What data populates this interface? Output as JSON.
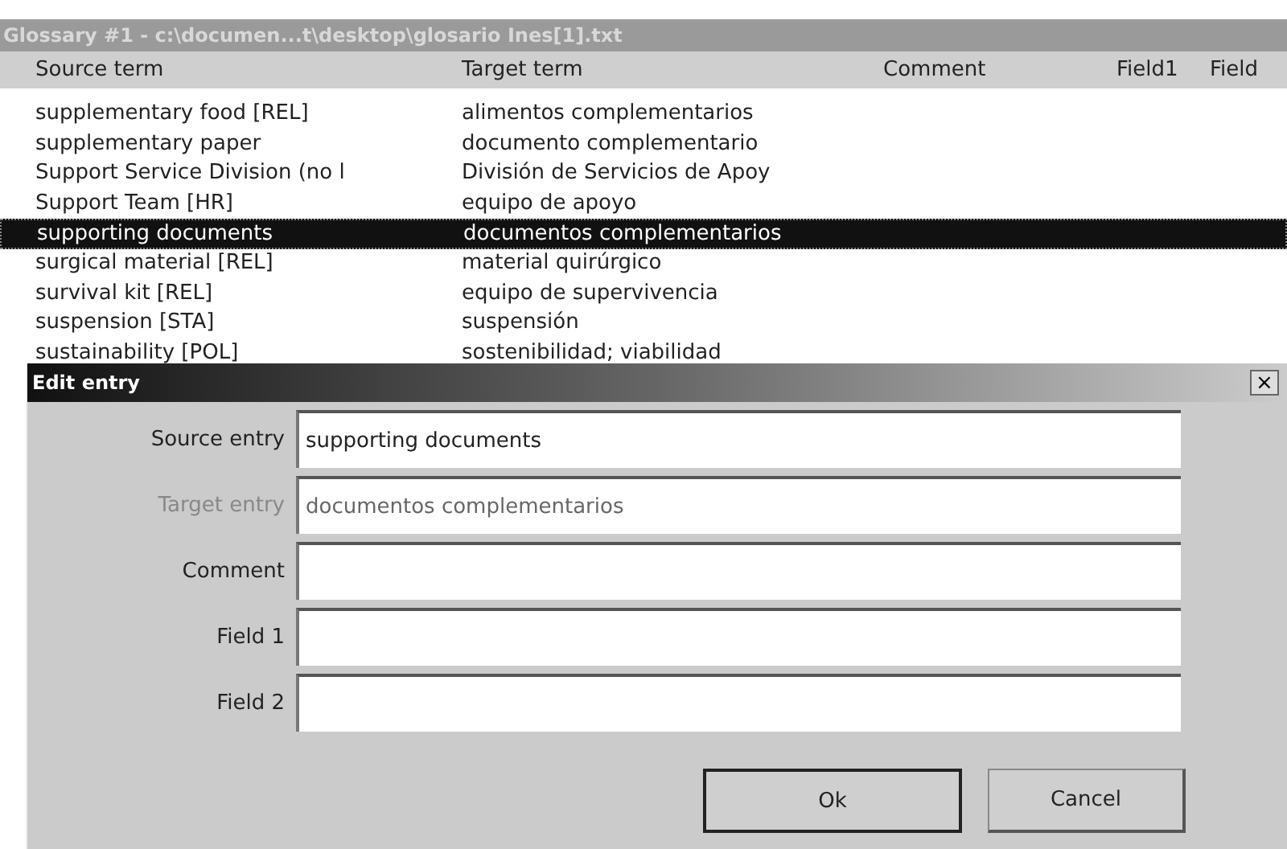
{
  "window": {
    "title": "Glossary #1 - c:\\documen...t\\desktop\\glosario Ines[1].txt",
    "active": false
  },
  "table": {
    "columns": [
      "Source term",
      "Target term",
      "Comment",
      "Field1",
      "Field"
    ],
    "rows": [
      {
        "source": "supplementary food [REL]",
        "target": "alimentos complementarios",
        "selected": false
      },
      {
        "source": "supplementary paper",
        "target": "documento complementario",
        "selected": false
      },
      {
        "source": "Support Service Division (no l",
        "target": "División de Servicios de Apoy",
        "selected": false
      },
      {
        "source": "Support Team [HR]",
        "target": "equipo de apoyo",
        "selected": false
      },
      {
        "source": "supporting documents",
        "target": "documentos complementarios",
        "selected": true
      },
      {
        "source": "surgical material [REL]",
        "target": "material quirúrgico",
        "selected": false
      },
      {
        "source": "survival kit [REL]",
        "target": "equipo de supervivencia",
        "selected": false
      },
      {
        "source": "suspension [STA]",
        "target": "suspensión",
        "selected": false
      },
      {
        "source": "sustainability [POL]",
        "target": "sostenibilidad; viabilidad",
        "selected": false
      }
    ]
  },
  "dialog": {
    "title": "Edit entry",
    "close": "×",
    "fields": [
      {
        "label": "Source entry",
        "value": "supporting documents",
        "disabled": false
      },
      {
        "label": "Target entry",
        "value": "documentos complementarios",
        "disabled": true
      },
      {
        "label": "Comment",
        "disabled": false
      },
      {
        "label": "Field 1",
        "disabled": false
      },
      {
        "label": "Field 2",
        "disabled": false
      }
    ],
    "buttons": [
      {
        "label": "Ok",
        "default": true
      },
      {
        "label": "Cancel",
        "default": false
      }
    ]
  }
}
